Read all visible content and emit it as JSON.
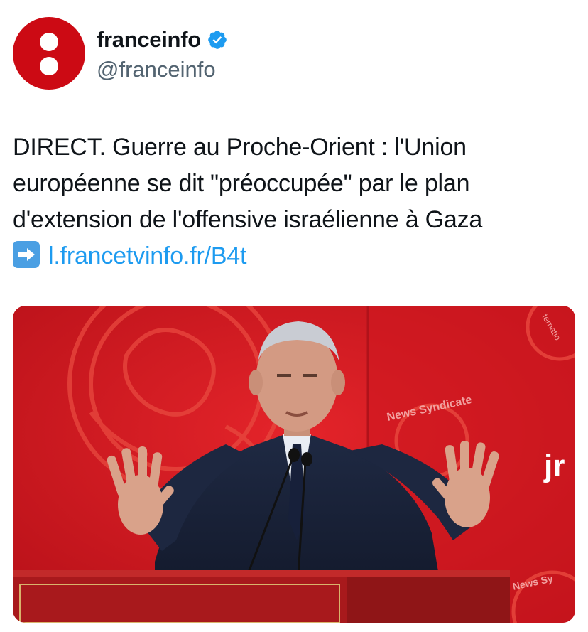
{
  "account": {
    "display_name": "franceinfo",
    "handle": "@franceinfo",
    "verified": true,
    "avatar_color": "#cc0a14"
  },
  "tweet": {
    "lines": [
      "DIRECT. Guerre au Proche-Orient : l'Union",
      "européenne se dit \"préoccupée\" par le plan",
      "d'extension de l'offensive israélienne à Gaza"
    ],
    "arrow_icon": "right-arrow-emoji",
    "link_text": "l.francetvinfo.fr/B4t",
    "link_color": "#1d9bf0"
  },
  "media": {
    "background_color": "#c8131b",
    "watermark_text_1": "News Syndicate",
    "watermark_text_2": "News Sy",
    "watermark_text_3": "ternatio",
    "logo_fragment": "jr"
  }
}
